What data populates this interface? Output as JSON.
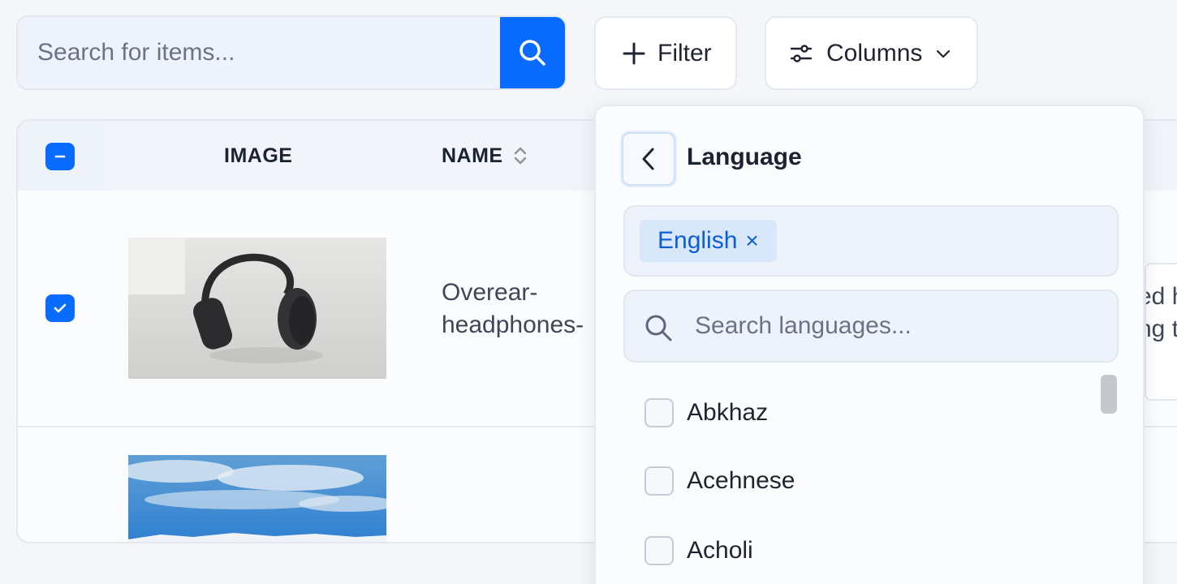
{
  "toolbar": {
    "search_placeholder": "Search for items...",
    "filter_label": "Filter",
    "columns_label": "Columns"
  },
  "table": {
    "headers": {
      "image": "IMAGE",
      "name": "NAME"
    },
    "rows": [
      {
        "name": "Overear-\nheadphones-",
        "selected": true,
        "image": "headphones-photo",
        "description_peek": [
          "ed h",
          "ng t"
        ]
      },
      {
        "name": "",
        "selected": false,
        "image": "sky-landscape-photo"
      }
    ]
  },
  "language_popover": {
    "title": "Language",
    "selected_chips": [
      "English"
    ],
    "chip_remove_symbol": "×",
    "search_placeholder": "Search languages...",
    "options": [
      "Abkhaz",
      "Acehnese",
      "Acholi"
    ]
  },
  "colors": {
    "accent": "#0a6cff",
    "chip_bg": "#d9e7fb",
    "chip_text": "#0a5ed8"
  }
}
